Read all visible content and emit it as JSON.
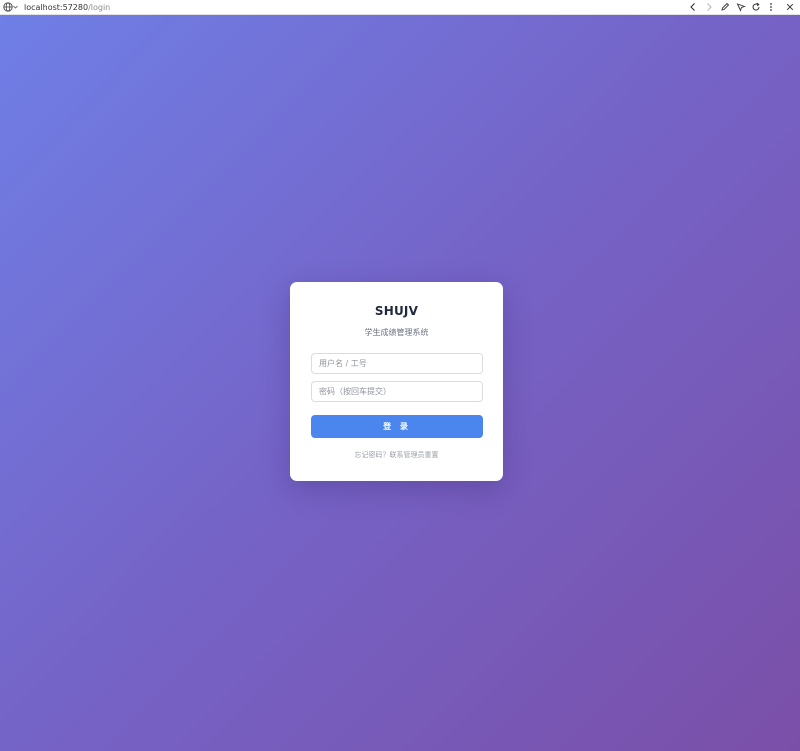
{
  "browser": {
    "url_host": "localhost:57280",
    "url_path": "/login"
  },
  "login": {
    "title": "SHUJV",
    "subtitle": "学生成绩管理系统",
    "username_placeholder": "用户名 / 工号",
    "password_placeholder": "密码（按回车提交）",
    "button_label": "登 录",
    "forgot_text": "忘记密码？联系管理员重置"
  },
  "colors": {
    "gradient_start": "#6f7fe6",
    "gradient_end": "#7a4fa8",
    "button": "#4a86ee",
    "title": "#1f2a3c"
  },
  "icons": [
    "globe-icon",
    "chevron-down-icon",
    "back-icon",
    "forward-icon",
    "edit-icon",
    "cursor-icon",
    "refresh-icon",
    "more-icon",
    "close-icon"
  ]
}
